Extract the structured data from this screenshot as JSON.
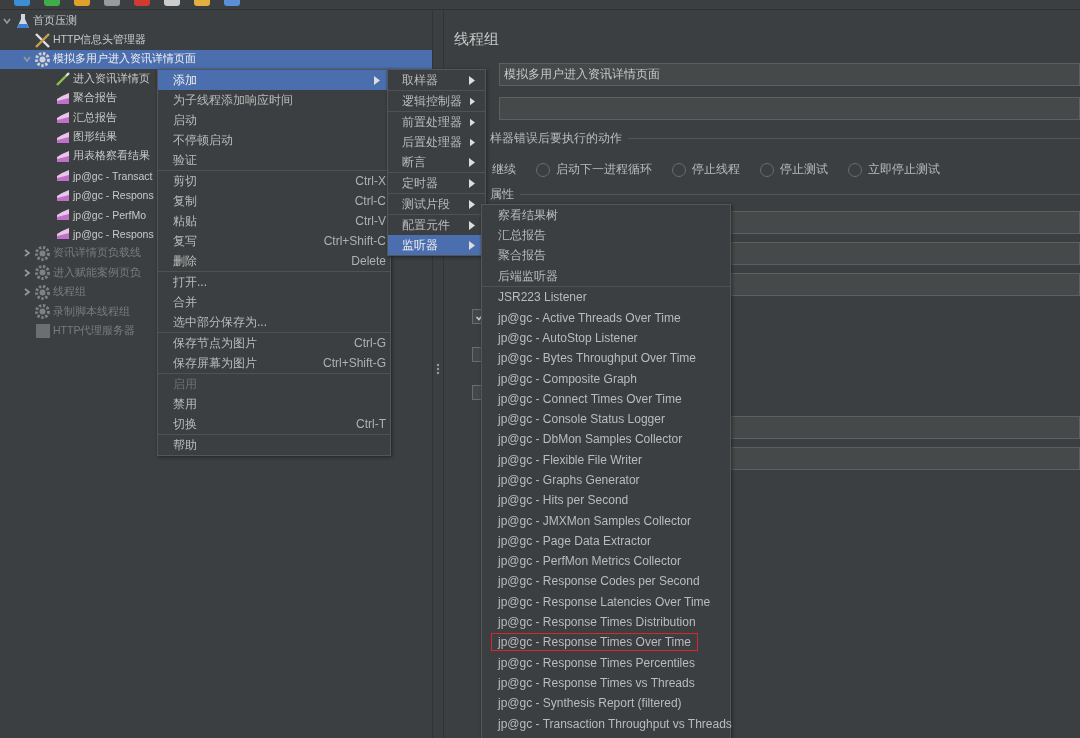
{
  "tree": [
    {
      "label": "首页压测",
      "kind": "plan",
      "expanded": true,
      "selected": false,
      "disabled": false,
      "children": [
        {
          "label": "HTTP信息头管理器",
          "kind": "config",
          "selected": false,
          "disabled": false
        },
        {
          "label": "模拟多用户进入资讯详情页面",
          "kind": "threads",
          "expanded": true,
          "selected": true,
          "disabled": false,
          "children": [
            {
              "label": "进入资讯详情页",
              "kind": "sampler",
              "selected": false,
              "disabled": false
            },
            {
              "label": "聚合报告",
              "kind": "listener",
              "selected": false,
              "disabled": false
            },
            {
              "label": "汇总报告",
              "kind": "listener",
              "selected": false,
              "disabled": false
            },
            {
              "label": "图形结果",
              "kind": "listener",
              "selected": false,
              "disabled": false
            },
            {
              "label": "用表格察看结果",
              "kind": "listener",
              "selected": false,
              "disabled": false
            },
            {
              "label": "jp@gc - Transact",
              "kind": "listener",
              "selected": false,
              "disabled": false
            },
            {
              "label": "jp@gc - Respons",
              "kind": "listener",
              "selected": false,
              "disabled": false
            },
            {
              "label": "jp@gc - PerfMo",
              "kind": "listener",
              "selected": false,
              "disabled": false
            },
            {
              "label": "jp@gc - Respons",
              "kind": "listener",
              "selected": false,
              "disabled": false
            }
          ]
        },
        {
          "label": "资讯详情页负载线",
          "kind": "threads",
          "expanded": false,
          "selected": false,
          "disabled": true
        },
        {
          "label": "进入赋能案例页负",
          "kind": "threads",
          "expanded": false,
          "selected": false,
          "disabled": true
        },
        {
          "label": "线程组",
          "kind": "threads",
          "expanded": false,
          "selected": false,
          "disabled": true
        },
        {
          "label": "录制脚本线程组",
          "kind": "threads",
          "selected": false,
          "disabled": true
        },
        {
          "label": "HTTP代理服务器",
          "kind": "proxy",
          "selected": false,
          "disabled": true
        }
      ]
    }
  ],
  "panel": {
    "title": "线程组",
    "name_value": "模拟多用户进入资讯详情页面",
    "error_section": "样器错误后要执行的动作",
    "continue_label": "继续",
    "radio_options": [
      {
        "label": "启动下一进程循环",
        "selected": false
      },
      {
        "label": "停止线程",
        "selected": false
      },
      {
        "label": "停止测试",
        "selected": false
      },
      {
        "label": "立即停止测试",
        "selected": false
      }
    ],
    "props_section": "属性",
    "checkboxes": [
      {
        "checked": true
      },
      {
        "checked": false
      },
      {
        "checked": false
      }
    ]
  },
  "context_menu": [
    [
      {
        "label": "添加",
        "submenu": true,
        "selected": true,
        "disabled": false
      },
      {
        "label": "为子线程添加响应时间",
        "submenu": false,
        "selected": false,
        "disabled": false
      },
      {
        "label": "启动",
        "submenu": false,
        "selected": false,
        "disabled": false
      },
      {
        "label": "不停顿启动",
        "submenu": false,
        "selected": false,
        "disabled": false
      },
      {
        "label": "验证",
        "submenu": false,
        "selected": false,
        "disabled": false
      }
    ],
    [
      {
        "label": "剪切",
        "shortcut": "Ctrl-X",
        "submenu": false,
        "selected": false,
        "disabled": false
      },
      {
        "label": "复制",
        "shortcut": "Ctrl-C",
        "submenu": false,
        "selected": false,
        "disabled": false
      },
      {
        "label": "粘贴",
        "shortcut": "Ctrl-V",
        "submenu": false,
        "selected": false,
        "disabled": false
      },
      {
        "label": "复写",
        "shortcut": "Ctrl+Shift-C",
        "submenu": false,
        "selected": false,
        "disabled": false
      },
      {
        "label": "删除",
        "shortcut": "Delete",
        "submenu": false,
        "selected": false,
        "disabled": false
      }
    ],
    [
      {
        "label": "打开...",
        "submenu": false,
        "selected": false,
        "disabled": false
      },
      {
        "label": "合并",
        "submenu": false,
        "selected": false,
        "disabled": false
      },
      {
        "label": "选中部分保存为...",
        "submenu": false,
        "selected": false,
        "disabled": false
      }
    ],
    [
      {
        "label": "保存节点为图片",
        "shortcut": "Ctrl-G",
        "submenu": false,
        "selected": false,
        "disabled": false
      },
      {
        "label": "保存屏幕为图片",
        "shortcut": "Ctrl+Shift-G",
        "submenu": false,
        "selected": false,
        "disabled": false
      }
    ],
    [
      {
        "label": "启用",
        "submenu": false,
        "selected": false,
        "disabled": true
      },
      {
        "label": "禁用",
        "submenu": false,
        "selected": false,
        "disabled": false
      },
      {
        "label": "切换",
        "shortcut": "Ctrl-T",
        "submenu": false,
        "selected": false,
        "disabled": false
      }
    ],
    [
      {
        "label": "帮助",
        "submenu": false,
        "selected": false,
        "disabled": false
      }
    ]
  ],
  "add_submenu": [
    [
      {
        "label": "取样器",
        "selected": false
      }
    ],
    [
      {
        "label": "逻辑控制器",
        "selected": false
      }
    ],
    [
      {
        "label": "前置处理器",
        "selected": false
      },
      {
        "label": "后置处理器",
        "selected": false
      },
      {
        "label": "断言",
        "selected": false
      }
    ],
    [
      {
        "label": "定时器",
        "selected": false
      }
    ],
    [
      {
        "label": "测试片段",
        "selected": false
      }
    ],
    [
      {
        "label": "配置元件",
        "selected": false
      },
      {
        "label": "监听器",
        "selected": true
      }
    ]
  ],
  "listener_submenu": [
    [
      {
        "label": "察看结果树",
        "outlined": false
      },
      {
        "label": "汇总报告",
        "outlined": false
      },
      {
        "label": "聚合报告",
        "outlined": false
      },
      {
        "label": "后端监听器",
        "outlined": false
      }
    ],
    [
      {
        "label": "JSR223 Listener",
        "outlined": false
      },
      {
        "label": "jp@gc - Active Threads Over Time",
        "outlined": false
      },
      {
        "label": "jp@gc - AutoStop Listener",
        "outlined": false
      },
      {
        "label": "jp@gc - Bytes Throughput Over Time",
        "outlined": false
      },
      {
        "label": "jp@gc - Composite Graph",
        "outlined": false
      },
      {
        "label": "jp@gc - Connect Times Over Time",
        "outlined": false
      },
      {
        "label": "jp@gc - Console Status Logger",
        "outlined": false
      },
      {
        "label": "jp@gc - DbMon Samples Collector",
        "outlined": false
      },
      {
        "label": "jp@gc - Flexible File Writer",
        "outlined": false
      },
      {
        "label": "jp@gc - Graphs Generator",
        "outlined": false
      },
      {
        "label": "jp@gc - Hits per Second",
        "outlined": false
      },
      {
        "label": "jp@gc - JMXMon Samples Collector",
        "outlined": false
      },
      {
        "label": "jp@gc - Page Data Extractor",
        "outlined": false
      },
      {
        "label": "jp@gc - PerfMon Metrics Collector",
        "outlined": false
      },
      {
        "label": "jp@gc - Response Codes per Second",
        "outlined": false
      },
      {
        "label": "jp@gc - Response Latencies Over Time",
        "outlined": false
      },
      {
        "label": "jp@gc - Response Times Distribution",
        "outlined": false
      },
      {
        "label": "jp@gc - Response Times Over Time",
        "outlined": true
      },
      {
        "label": "jp@gc - Response Times Percentiles",
        "outlined": false
      },
      {
        "label": "jp@gc - Response Times vs Threads",
        "outlined": false
      },
      {
        "label": "jp@gc - Synthesis Report (filtered)",
        "outlined": false
      },
      {
        "label": "jp@gc - Transaction Throughput vs Threads",
        "outlined": false
      }
    ]
  ]
}
